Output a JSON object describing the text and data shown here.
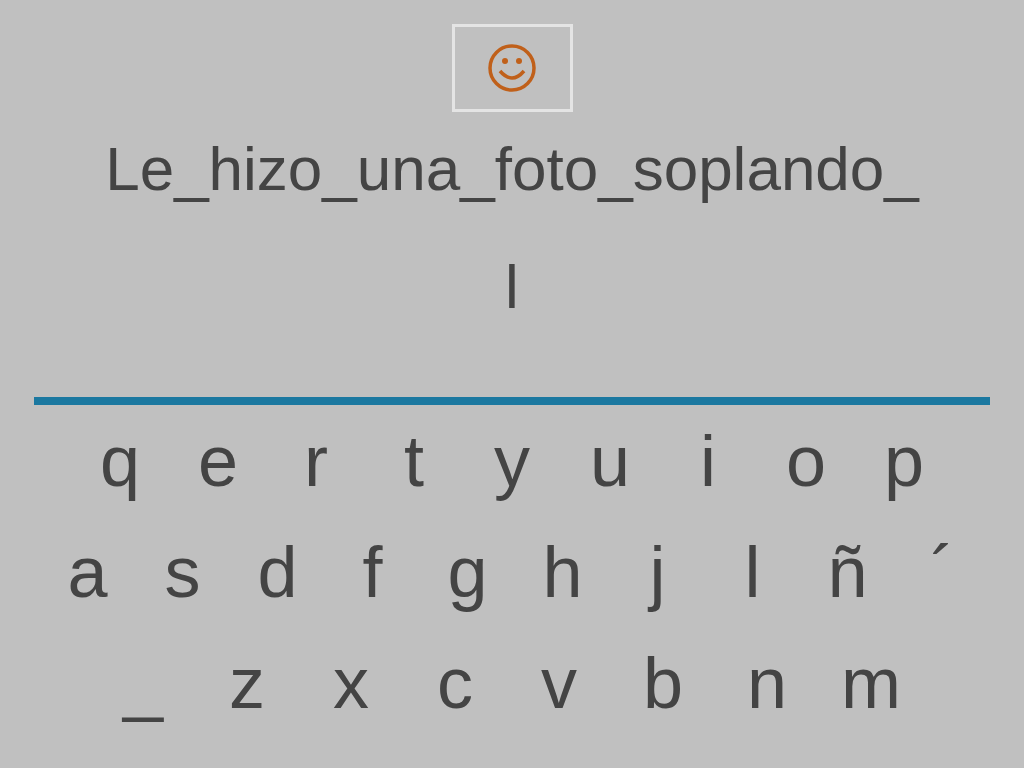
{
  "sentence": "Le_hizo_una_foto_soplando_",
  "answer": "l",
  "keyboard": [
    [
      "q",
      "e",
      "r",
      "t",
      "y",
      "u",
      "i",
      "o",
      "p"
    ],
    [
      "a",
      "s",
      "d",
      "f",
      "g",
      "h",
      "j",
      "l",
      "ñ",
      "´"
    ],
    [
      "_",
      "z",
      "x",
      "c",
      "v",
      "b",
      "n",
      "m"
    ]
  ]
}
